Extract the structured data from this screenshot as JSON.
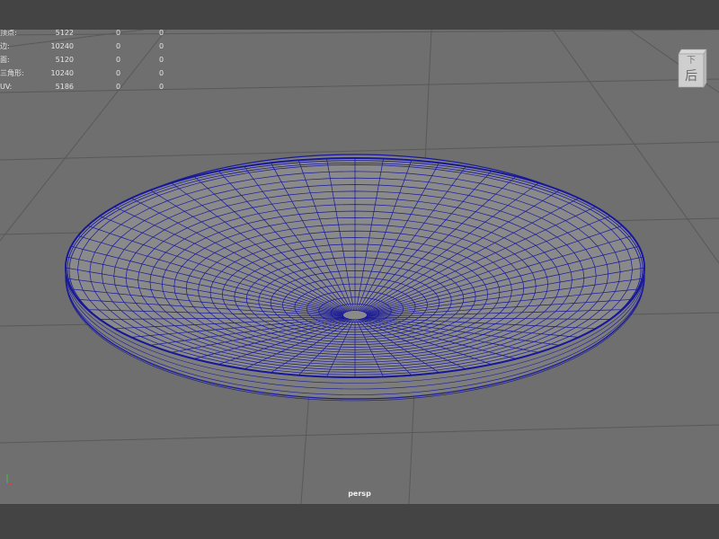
{
  "viewport": {
    "camera": "persp",
    "colors": {
      "background": "#6f6f6f",
      "grid": "#595959",
      "mesh_fill": "#8a8a8a",
      "wire": "#18189a",
      "hud_text": "#e6e6e6"
    }
  },
  "hud_stats": [
    {
      "label": "顶点:",
      "v1": "5122",
      "v2": "0",
      "v3": "0"
    },
    {
      "label": "边:",
      "v1": "10240",
      "v2": "0",
      "v3": "0"
    },
    {
      "label": "面:",
      "v1": "5120",
      "v2": "0",
      "v3": "0"
    },
    {
      "label": "三角形:",
      "v1": "10240",
      "v2": "0",
      "v3": "0"
    },
    {
      "label": "UV:",
      "v1": "5186",
      "v2": "0",
      "v3": "0"
    }
  ],
  "view_cube": {
    "face_top": "下",
    "face_front": "后"
  },
  "icons": {
    "view_cube": "view-cube-icon",
    "axis": "axis-gizmo-icon"
  }
}
